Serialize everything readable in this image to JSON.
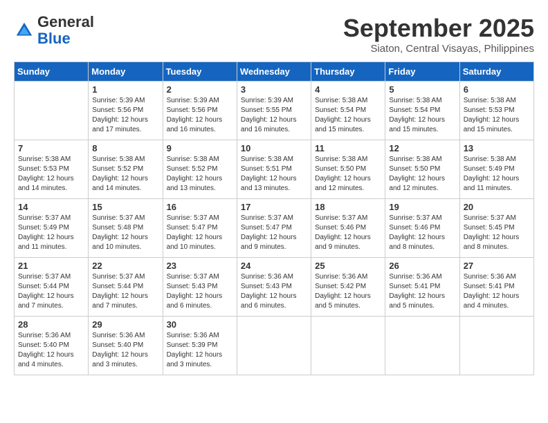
{
  "header": {
    "logo_general": "General",
    "logo_blue": "Blue",
    "month_title": "September 2025",
    "location": "Siaton, Central Visayas, Philippines"
  },
  "weekdays": [
    "Sunday",
    "Monday",
    "Tuesday",
    "Wednesday",
    "Thursday",
    "Friday",
    "Saturday"
  ],
  "weeks": [
    [
      {
        "day": "",
        "sunrise": "",
        "sunset": "",
        "daylight": ""
      },
      {
        "day": "1",
        "sunrise": "Sunrise: 5:39 AM",
        "sunset": "Sunset: 5:56 PM",
        "daylight": "Daylight: 12 hours and 17 minutes."
      },
      {
        "day": "2",
        "sunrise": "Sunrise: 5:39 AM",
        "sunset": "Sunset: 5:56 PM",
        "daylight": "Daylight: 12 hours and 16 minutes."
      },
      {
        "day": "3",
        "sunrise": "Sunrise: 5:39 AM",
        "sunset": "Sunset: 5:55 PM",
        "daylight": "Daylight: 12 hours and 16 minutes."
      },
      {
        "day": "4",
        "sunrise": "Sunrise: 5:38 AM",
        "sunset": "Sunset: 5:54 PM",
        "daylight": "Daylight: 12 hours and 15 minutes."
      },
      {
        "day": "5",
        "sunrise": "Sunrise: 5:38 AM",
        "sunset": "Sunset: 5:54 PM",
        "daylight": "Daylight: 12 hours and 15 minutes."
      },
      {
        "day": "6",
        "sunrise": "Sunrise: 5:38 AM",
        "sunset": "Sunset: 5:53 PM",
        "daylight": "Daylight: 12 hours and 15 minutes."
      }
    ],
    [
      {
        "day": "7",
        "sunrise": "Sunrise: 5:38 AM",
        "sunset": "Sunset: 5:53 PM",
        "daylight": "Daylight: 12 hours and 14 minutes."
      },
      {
        "day": "8",
        "sunrise": "Sunrise: 5:38 AM",
        "sunset": "Sunset: 5:52 PM",
        "daylight": "Daylight: 12 hours and 14 minutes."
      },
      {
        "day": "9",
        "sunrise": "Sunrise: 5:38 AM",
        "sunset": "Sunset: 5:52 PM",
        "daylight": "Daylight: 12 hours and 13 minutes."
      },
      {
        "day": "10",
        "sunrise": "Sunrise: 5:38 AM",
        "sunset": "Sunset: 5:51 PM",
        "daylight": "Daylight: 12 hours and 13 minutes."
      },
      {
        "day": "11",
        "sunrise": "Sunrise: 5:38 AM",
        "sunset": "Sunset: 5:50 PM",
        "daylight": "Daylight: 12 hours and 12 minutes."
      },
      {
        "day": "12",
        "sunrise": "Sunrise: 5:38 AM",
        "sunset": "Sunset: 5:50 PM",
        "daylight": "Daylight: 12 hours and 12 minutes."
      },
      {
        "day": "13",
        "sunrise": "Sunrise: 5:38 AM",
        "sunset": "Sunset: 5:49 PM",
        "daylight": "Daylight: 12 hours and 11 minutes."
      }
    ],
    [
      {
        "day": "14",
        "sunrise": "Sunrise: 5:37 AM",
        "sunset": "Sunset: 5:49 PM",
        "daylight": "Daylight: 12 hours and 11 minutes."
      },
      {
        "day": "15",
        "sunrise": "Sunrise: 5:37 AM",
        "sunset": "Sunset: 5:48 PM",
        "daylight": "Daylight: 12 hours and 10 minutes."
      },
      {
        "day": "16",
        "sunrise": "Sunrise: 5:37 AM",
        "sunset": "Sunset: 5:47 PM",
        "daylight": "Daylight: 12 hours and 10 minutes."
      },
      {
        "day": "17",
        "sunrise": "Sunrise: 5:37 AM",
        "sunset": "Sunset: 5:47 PM",
        "daylight": "Daylight: 12 hours and 9 minutes."
      },
      {
        "day": "18",
        "sunrise": "Sunrise: 5:37 AM",
        "sunset": "Sunset: 5:46 PM",
        "daylight": "Daylight: 12 hours and 9 minutes."
      },
      {
        "day": "19",
        "sunrise": "Sunrise: 5:37 AM",
        "sunset": "Sunset: 5:46 PM",
        "daylight": "Daylight: 12 hours and 8 minutes."
      },
      {
        "day": "20",
        "sunrise": "Sunrise: 5:37 AM",
        "sunset": "Sunset: 5:45 PM",
        "daylight": "Daylight: 12 hours and 8 minutes."
      }
    ],
    [
      {
        "day": "21",
        "sunrise": "Sunrise: 5:37 AM",
        "sunset": "Sunset: 5:44 PM",
        "daylight": "Daylight: 12 hours and 7 minutes."
      },
      {
        "day": "22",
        "sunrise": "Sunrise: 5:37 AM",
        "sunset": "Sunset: 5:44 PM",
        "daylight": "Daylight: 12 hours and 7 minutes."
      },
      {
        "day": "23",
        "sunrise": "Sunrise: 5:37 AM",
        "sunset": "Sunset: 5:43 PM",
        "daylight": "Daylight: 12 hours and 6 minutes."
      },
      {
        "day": "24",
        "sunrise": "Sunrise: 5:36 AM",
        "sunset": "Sunset: 5:43 PM",
        "daylight": "Daylight: 12 hours and 6 minutes."
      },
      {
        "day": "25",
        "sunrise": "Sunrise: 5:36 AM",
        "sunset": "Sunset: 5:42 PM",
        "daylight": "Daylight: 12 hours and 5 minutes."
      },
      {
        "day": "26",
        "sunrise": "Sunrise: 5:36 AM",
        "sunset": "Sunset: 5:41 PM",
        "daylight": "Daylight: 12 hours and 5 minutes."
      },
      {
        "day": "27",
        "sunrise": "Sunrise: 5:36 AM",
        "sunset": "Sunset: 5:41 PM",
        "daylight": "Daylight: 12 hours and 4 minutes."
      }
    ],
    [
      {
        "day": "28",
        "sunrise": "Sunrise: 5:36 AM",
        "sunset": "Sunset: 5:40 PM",
        "daylight": "Daylight: 12 hours and 4 minutes."
      },
      {
        "day": "29",
        "sunrise": "Sunrise: 5:36 AM",
        "sunset": "Sunset: 5:40 PM",
        "daylight": "Daylight: 12 hours and 3 minutes."
      },
      {
        "day": "30",
        "sunrise": "Sunrise: 5:36 AM",
        "sunset": "Sunset: 5:39 PM",
        "daylight": "Daylight: 12 hours and 3 minutes."
      },
      {
        "day": "",
        "sunrise": "",
        "sunset": "",
        "daylight": ""
      },
      {
        "day": "",
        "sunrise": "",
        "sunset": "",
        "daylight": ""
      },
      {
        "day": "",
        "sunrise": "",
        "sunset": "",
        "daylight": ""
      },
      {
        "day": "",
        "sunrise": "",
        "sunset": "",
        "daylight": ""
      }
    ]
  ]
}
